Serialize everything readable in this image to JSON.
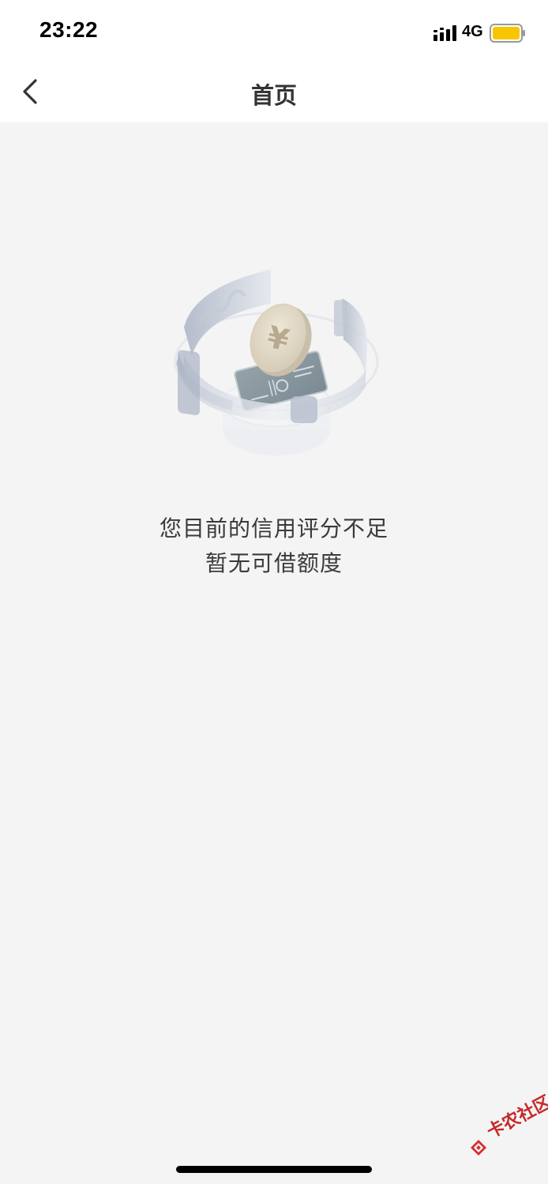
{
  "status_bar": {
    "time": "23:22",
    "network": "4G",
    "battery_color": "#f7c600"
  },
  "nav": {
    "title": "首页",
    "back_icon": "chevron-left-icon"
  },
  "empty_state": {
    "illustration": "coin-card-ring-illustration",
    "coin_symbol": "¥",
    "line1": "您目前的信用评分不足",
    "line2": "暂无可借额度"
  },
  "watermark": {
    "text": "卡农社区"
  }
}
